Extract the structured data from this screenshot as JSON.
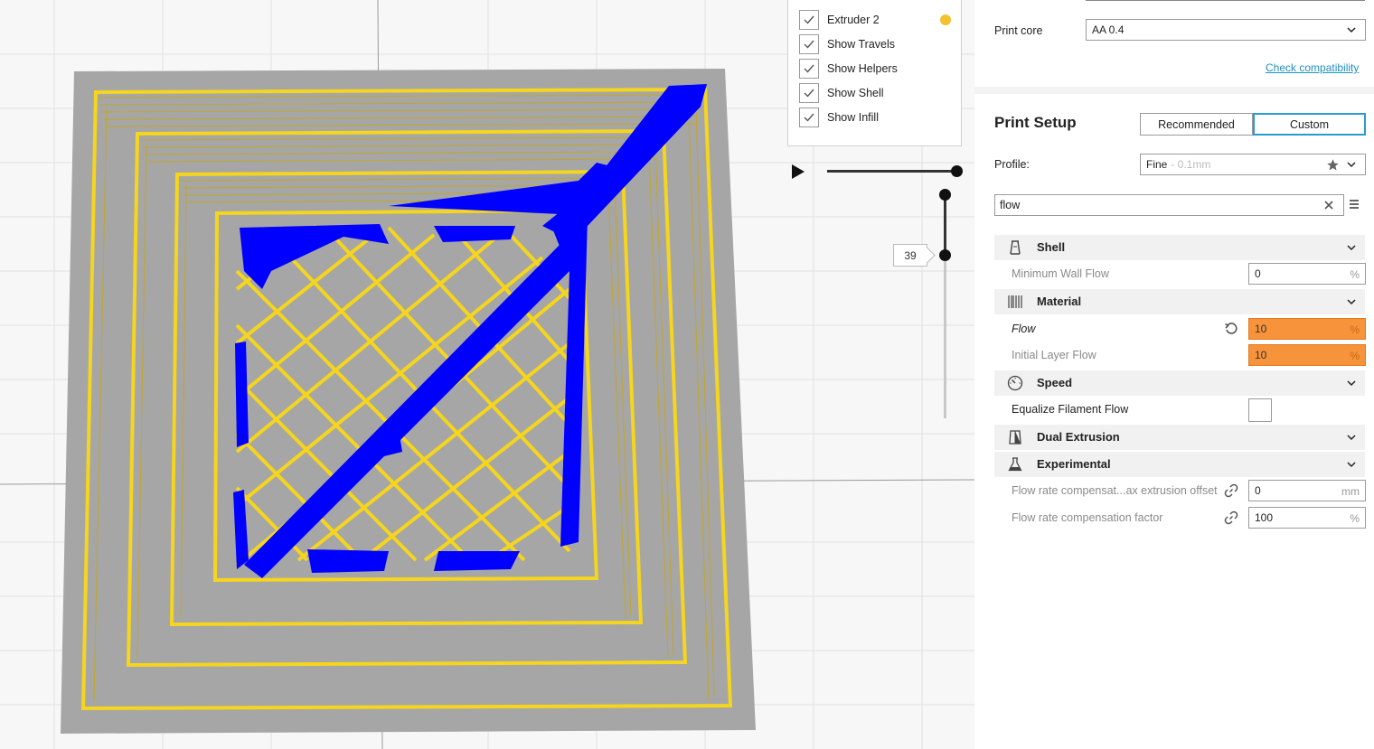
{
  "layer_view": {
    "items": [
      {
        "label": "Extruder 2",
        "checked": true
      },
      {
        "label": "Show Travels",
        "checked": true
      },
      {
        "label": "Show Helpers",
        "checked": true
      },
      {
        "label": "Show Shell",
        "checked": true
      },
      {
        "label": "Show Infill",
        "checked": true
      }
    ],
    "extruder2_color": "#f2c12e",
    "current_layer": "39"
  },
  "colors": {
    "shell": "#f5d51d",
    "helpers": "#0000ff",
    "build_plate": "#a6a6a6",
    "accent": "#2a9bd0",
    "error_field": "#f7933a"
  },
  "printer": {
    "print_core_label": "Print core",
    "print_core_value": "AA 0.4",
    "check_compat": "Check compatibility"
  },
  "print_setup": {
    "title": "Print Setup",
    "tab_recommended": "Recommended",
    "tab_custom": "Custom",
    "profile_label": "Profile:",
    "profile_value": "Fine",
    "profile_suffix": "- 0.1mm",
    "search_value": "flow"
  },
  "settings": {
    "shell": {
      "label": "Shell",
      "icon": "shell-icon"
    },
    "min_wall_flow": {
      "label": "Minimum Wall Flow",
      "value": "0",
      "unit": "%"
    },
    "material": {
      "label": "Material",
      "icon": "material-icon"
    },
    "flow": {
      "label": "Flow",
      "value": "10",
      "unit": "%"
    },
    "initial_layer_flow": {
      "label": "Initial Layer Flow",
      "value": "10",
      "unit": "%"
    },
    "speed": {
      "label": "Speed",
      "icon": "speed-icon"
    },
    "equalize": {
      "label": "Equalize Filament Flow",
      "checked": false
    },
    "dual": {
      "label": "Dual Extrusion",
      "icon": "dual-extrusion-icon"
    },
    "experimental": {
      "label": "Experimental",
      "icon": "experimental-icon"
    },
    "fr_comp_offset": {
      "label": "Flow rate compensat...ax extrusion offset",
      "value": "0",
      "unit": "mm"
    },
    "fr_comp_factor": {
      "label": "Flow rate compensation factor",
      "value": "100",
      "unit": "%"
    }
  }
}
